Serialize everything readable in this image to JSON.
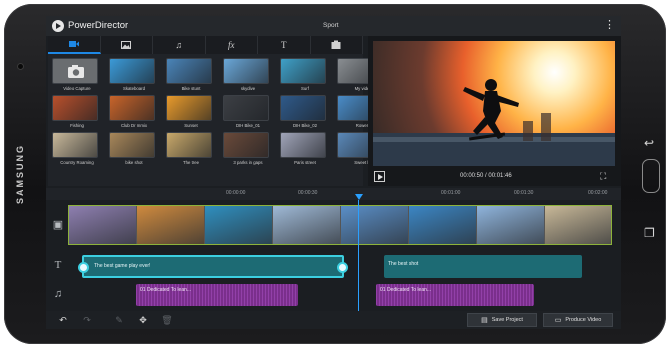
{
  "device": {
    "brand": "SAMSUNG"
  },
  "app": {
    "title": "PowerDirector",
    "project_name": "Sport",
    "more_icon": "more-vertical-icon"
  },
  "library": {
    "tabs": [
      {
        "id": "video",
        "icon": "video-camera-icon",
        "active": true
      },
      {
        "id": "photo",
        "icon": "photo-icon",
        "active": false
      },
      {
        "id": "music",
        "icon": "music-note-icon",
        "active": false
      },
      {
        "id": "effects",
        "icon": "fx-icon",
        "label": "fx",
        "active": false
      },
      {
        "id": "title",
        "icon": "text-icon",
        "label": "T",
        "active": false
      },
      {
        "id": "overlay",
        "icon": "overlay-icon",
        "active": false
      }
    ],
    "items": [
      {
        "label": "Video Capture",
        "color": "#6a6d70"
      },
      {
        "label": "Skateboard",
        "color": "#3b9ad8"
      },
      {
        "label": "Bike stunt",
        "color": "#4a84b8"
      },
      {
        "label": "skydive",
        "color": "#6aa7d8"
      },
      {
        "label": "Surf",
        "color": "#3fa0c8"
      },
      {
        "label": "My vide",
        "color": "#8a8e92"
      },
      {
        "label": "Fishing",
        "color": "#b8502c"
      },
      {
        "label": "Club Dr mmix",
        "color": "#c8642a"
      },
      {
        "label": "Sunset",
        "color": "#e89a2c"
      },
      {
        "label": "DIH Bike_01",
        "color": "#3c3f44"
      },
      {
        "label": "DIH Bike_02",
        "color": "#2f5a8a"
      },
      {
        "label": "Rower",
        "color": "#4a8cc8"
      },
      {
        "label": "Country Roaming",
        "color": "#c8b89a"
      },
      {
        "label": "bike shot",
        "color": "#a8875a"
      },
      {
        "label": "The tree",
        "color": "#c8a86a"
      },
      {
        "label": "3 parks in gaps",
        "color": "#6a4a3a"
      },
      {
        "label": "Paris street",
        "color": "#a0a4b8"
      },
      {
        "label": "Sweet b",
        "color": "#5a88b8"
      }
    ]
  },
  "preview": {
    "timecode": "00:00:50 / 00:01:46"
  },
  "timeline": {
    "ruler_ticks": [
      "00:00:00",
      "00:00:30",
      "00:01:00",
      "00:01:30",
      "00:02:00"
    ],
    "video_clips": [
      "#8e7fb0",
      "#cf8a3e",
      "#2f8fbf",
      "#9fb9d6",
      "#5a8fc8",
      "#3b86c4",
      "#8fb4dc",
      "#c8b898"
    ],
    "titles": [
      {
        "text": "The best game play ever!",
        "selected": true
      },
      {
        "text": "The best shot",
        "selected": false
      }
    ],
    "audio": [
      {
        "text": "01 Dedicated To lean..."
      },
      {
        "text": "01 Dedicated To lean..."
      }
    ]
  },
  "toolbar": {
    "save_label": "Save Project",
    "produce_label": "Produce Video"
  }
}
